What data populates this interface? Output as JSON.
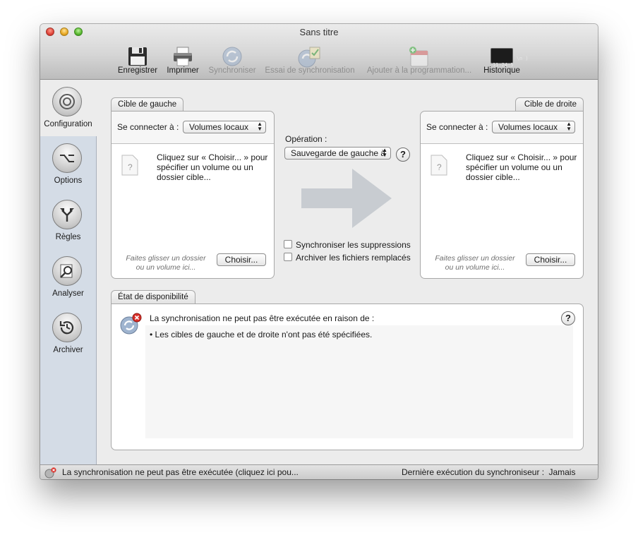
{
  "window": {
    "title": "Sans titre"
  },
  "toolbar": {
    "items": [
      {
        "label": "Enregistrer",
        "icon": "floppy-disk-icon",
        "enabled": true
      },
      {
        "label": "Imprimer",
        "icon": "printer-icon",
        "enabled": true
      },
      {
        "label": "Synchroniser",
        "icon": "sync-icon",
        "enabled": false
      },
      {
        "label": "Essai de synchronisation",
        "icon": "sync-test-icon",
        "enabled": false
      },
      {
        "label": "Ajouter à la programmation...",
        "icon": "calendar-add-icon",
        "enabled": false
      },
      {
        "label": "Historique",
        "icon": "console-icon",
        "enabled": true
      }
    ],
    "console_text": "\\n )\n11:24:5"
  },
  "sidebar": {
    "items": [
      {
        "label": "Configuration",
        "icon": "target-icon",
        "active": true
      },
      {
        "label": "Options",
        "icon": "option-key-icon",
        "active": false
      },
      {
        "label": "Règles",
        "icon": "fork-arrows-icon",
        "active": false
      },
      {
        "label": "Analyser",
        "icon": "magnifier-icon",
        "active": false
      },
      {
        "label": "Archiver",
        "icon": "clock-restore-icon",
        "active": false
      }
    ]
  },
  "left_target": {
    "tab_label": "Cible de gauche",
    "connect_label": "Se connecter à :",
    "connect_value": "Volumes locaux",
    "hint": "Cliquez sur « Choisir... » pour spécifier un volume ou un dossier cible...",
    "drop_hint": "Faites glisser un dossier ou un volume ici...",
    "choose_button": "Choisir..."
  },
  "right_target": {
    "tab_label": "Cible de droite",
    "connect_label": "Se connecter à :",
    "connect_value": "Volumes locaux",
    "hint": "Cliquez sur « Choisir... » pour spécifier un volume ou un dossier cible...",
    "drop_hint": "Faites glisser un dossier ou un volume ici...",
    "choose_button": "Choisir..."
  },
  "operation": {
    "label": "Opération :",
    "value": "Sauvegarde de gauche à",
    "help": "?",
    "sync_deletions": "Synchroniser les suppressions",
    "archive_replaced": "Archiver les fichiers remplacés"
  },
  "availability": {
    "tab_label": "État de disponibilité",
    "message": "La synchronisation ne peut pas être exécutée en raison de :",
    "reason": "• Les cibles de gauche et de droite n'ont pas été spécifiées.",
    "help": "?"
  },
  "statusbar": {
    "message": "La synchronisation ne peut pas être exécutée (cliquez ici pou...",
    "last_run_label": "Dernière exécution du synchroniseur :",
    "last_run_value": "Jamais"
  },
  "colors": {
    "arrow": "#c8ccd1",
    "sidebar_bg": "#d4dce6",
    "error_red": "#d9302a"
  }
}
